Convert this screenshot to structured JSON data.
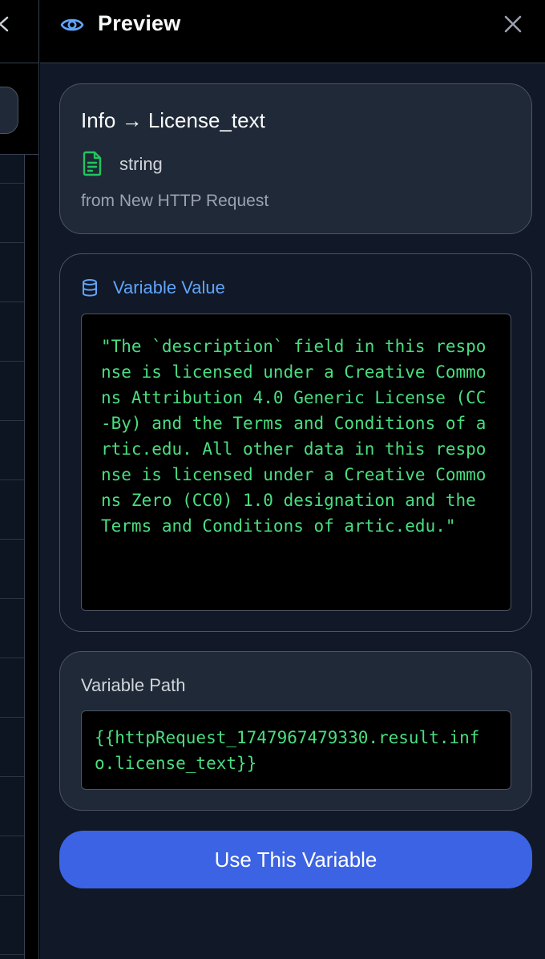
{
  "header": {
    "title": "Preview",
    "icon": "eye-icon",
    "close_icon": "close-icon"
  },
  "info_card": {
    "title": "Info → License_text",
    "type_icon": "file-text-icon",
    "type": "string",
    "source": "from New HTTP Request"
  },
  "value_card": {
    "icon": "database-icon",
    "label": "Variable Value",
    "value": "\"The `description` field in this response is licensed under a Creative Commons Attribution 4.0 Generic License (CC-By) and the Terms and Conditions of artic.edu. All other data in this response is licensed under a Creative Commons Zero (CC0) 1.0 designation and the Terms and Conditions of artic.edu.\""
  },
  "path_card": {
    "label": "Variable Path",
    "path": "{{httpRequest_1747967479330.result.info.license_text}}"
  },
  "actions": {
    "use_label": "Use This Variable"
  },
  "colors": {
    "accent": "#3b63e3",
    "code_text": "#4ade80",
    "label_blue": "#60a5fa",
    "file_icon_green": "#22c55e"
  }
}
